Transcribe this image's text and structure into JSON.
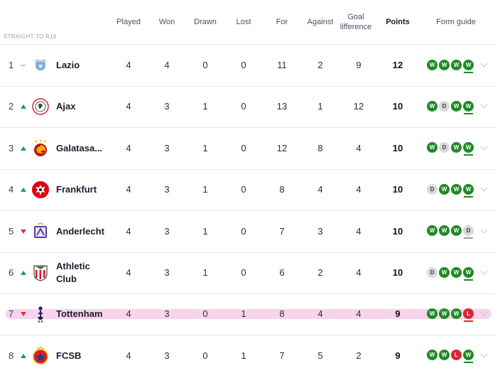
{
  "section_label": "STRAIGHT TO R16",
  "headers": {
    "played": "Played",
    "won": "Won",
    "drawn": "Drawn",
    "lost": "Lost",
    "for": "For",
    "against": "Against",
    "goal_difference_l1": "Goal",
    "goal_difference_l2": "lifference",
    "points": "Points",
    "form_guide": "Form guide"
  },
  "rows": [
    {
      "pos": "1",
      "move": "same",
      "team": "Lazio",
      "crest": "lazio-crest-icon",
      "played": "4",
      "won": "4",
      "drawn": "0",
      "lost": "0",
      "for": "11",
      "against": "2",
      "gd": "9",
      "points": "12",
      "form": [
        "W",
        "W",
        "W",
        "W"
      ]
    },
    {
      "pos": "2",
      "move": "up",
      "team": "Ajax",
      "crest": "ajax-crest-icon",
      "played": "4",
      "won": "3",
      "drawn": "1",
      "lost": "0",
      "for": "13",
      "against": "1",
      "gd": "12",
      "points": "10",
      "form": [
        "W",
        "D",
        "W",
        "W"
      ]
    },
    {
      "pos": "3",
      "move": "up",
      "team": "Galatasa...",
      "crest": "galatasaray-crest-icon",
      "played": "4",
      "won": "3",
      "drawn": "1",
      "lost": "0",
      "for": "12",
      "against": "8",
      "gd": "4",
      "points": "10",
      "form": [
        "W",
        "D",
        "W",
        "W"
      ]
    },
    {
      "pos": "4",
      "move": "up",
      "team": "Frankfurt",
      "crest": "frankfurt-crest-icon",
      "played": "4",
      "won": "3",
      "drawn": "1",
      "lost": "0",
      "for": "8",
      "against": "4",
      "gd": "4",
      "points": "10",
      "form": [
        "D",
        "W",
        "W",
        "W"
      ]
    },
    {
      "pos": "5",
      "move": "down",
      "team": "Anderlecht",
      "crest": "anderlecht-crest-icon",
      "played": "4",
      "won": "3",
      "drawn": "1",
      "lost": "0",
      "for": "7",
      "against": "3",
      "gd": "4",
      "points": "10",
      "form": [
        "W",
        "W",
        "W",
        "D"
      ]
    },
    {
      "pos": "6",
      "move": "up",
      "team": "Athletic Club",
      "team_l1": "Athletic",
      "team_l2": "Club",
      "crest": "athletic-club-crest-icon",
      "played": "4",
      "won": "3",
      "drawn": "1",
      "lost": "0",
      "for": "6",
      "against": "2",
      "gd": "4",
      "points": "10",
      "form": [
        "D",
        "W",
        "W",
        "W"
      ]
    },
    {
      "pos": "7",
      "move": "down",
      "team": "Tottenham",
      "crest": "tottenham-crest-icon",
      "played": "4",
      "won": "3",
      "drawn": "0",
      "lost": "1",
      "for": "8",
      "against": "4",
      "gd": "4",
      "points": "9",
      "form": [
        "W",
        "W",
        "W",
        "L"
      ],
      "highlight": true
    },
    {
      "pos": "8",
      "move": "up",
      "team": "FCSB",
      "crest": "fcsb-crest-icon",
      "played": "4",
      "won": "3",
      "drawn": "0",
      "lost": "1",
      "for": "7",
      "against": "5",
      "gd": "2",
      "points": "9",
      "form": [
        "W",
        "W",
        "L",
        "W"
      ]
    }
  ]
}
